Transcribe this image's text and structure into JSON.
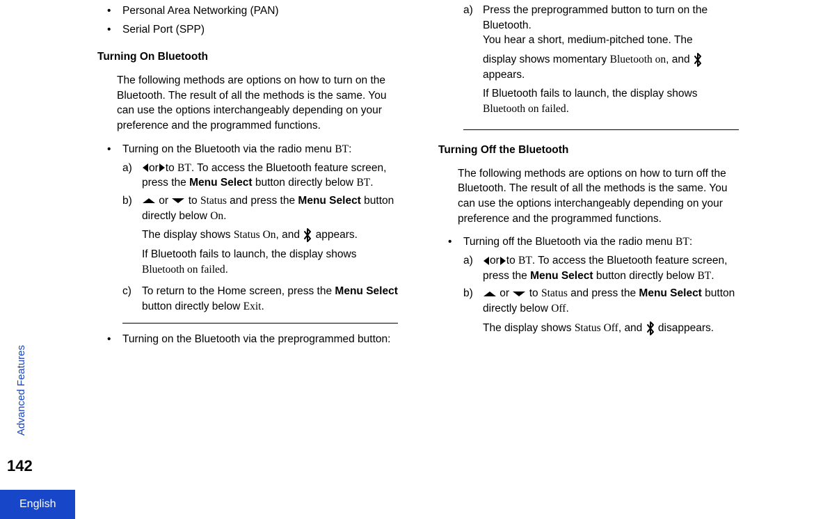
{
  "left": {
    "pan": "Personal Area Networking (PAN)",
    "spp": "Serial Port (SPP)",
    "heading_on": "Turning On Bluetooth",
    "intro_on": "The following methods are options on how to turn on the Bluetooth. The result of all the methods is the same. You can use the options interchangeably depending on your preference and the programmed functions.",
    "bullet_menu": "Turning on the Bluetooth via the radio menu ",
    "bt_label": "BT",
    "colon": ":",
    "a_label": "a)",
    "a_part1": "or",
    "a_part2": "to ",
    "a_part3": ". To access the Bluetooth feature screen, press the ",
    "menu_select": "Menu Select",
    "a_part4": " button directly below ",
    "period": ".",
    "b_label": "b)",
    "b_part1": " or ",
    "b_part2": " to ",
    "status_label": "Status",
    "b_part3": " and press the ",
    "b_part4": " button directly below ",
    "on_label": "On",
    "b_result1": "The display shows ",
    "status_on": "Status On",
    "comma_and": ", and ",
    "appears": "appears.",
    "b_fail1": "If Bluetooth fails to launch, the display shows ",
    "bt_on_failed": "Bluetooth on failed",
    "c_label": "c)",
    "c_text1": "To return to the Home screen, press the ",
    "c_text2": " button directly below ",
    "exit_label": "Exit",
    "bullet_button": "Turning on the Bluetooth via the preprogrammed button:"
  },
  "right": {
    "a_label": "a)",
    "a_line1": "Press the preprogrammed button to turn on the Bluetooth.",
    "a_line2": "You hear a short, medium-pitched tone. The",
    "a_line3a": "display shows momentary ",
    "bt_on": "Bluetooth on",
    "comma_and": ", and ",
    "appears": "appears.",
    "fail1": "If Bluetooth fails to launch, the display shows ",
    "bt_on_failed": "Bluetooth on failed",
    "period": ".",
    "heading_off": "Turning Off the Bluetooth",
    "intro_off": "The following methods are options on how to turn off the Bluetooth. The result of all the methods is the same. You can use the options interchangeably depending on your preference and the programmed functions.",
    "bullet_menu": "Turning off the Bluetooth via the radio menu ",
    "bt_label": "BT",
    "colon": ":",
    "a2_label": "a)",
    "a2_part1": "or",
    "a2_part2": "to ",
    "a2_part3": ". To access the Bluetooth feature screen, press the ",
    "menu_select": "Menu Select",
    "a2_part4": " button directly below ",
    "b2_label": "b)",
    "b2_part1": " or ",
    "b2_part2": " to ",
    "status_label": "Status",
    "b2_part3": " and press the ",
    "b2_part4": " button directly below ",
    "off_label": "Off",
    "b2_result1": "The display shows ",
    "status_off": "Status Off",
    "disappears": "disappears."
  },
  "side_tab": "Advanced Features",
  "page_num": "142",
  "language": "English"
}
